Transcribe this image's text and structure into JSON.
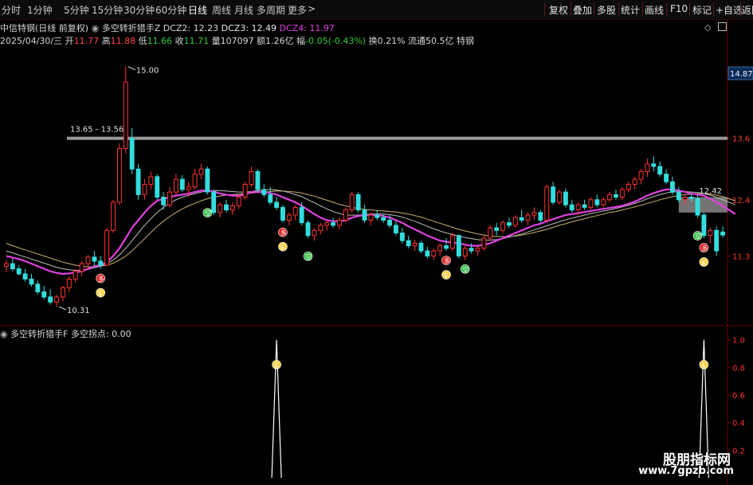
{
  "toolbar": {
    "periods": [
      "分时",
      "1分钟",
      "5分钟",
      "15分钟",
      "30分钟",
      "60分钟",
      "日线",
      "周线",
      "月线",
      "多周期",
      "更多"
    ],
    "active_period": "日线",
    "more_glyph": ">",
    "actions": [
      "复权",
      "叠加",
      "多股",
      "统计",
      "画线",
      "F10",
      "标记",
      "+自选",
      "返回"
    ]
  },
  "info": {
    "title": "中信特钢(日线 前复权)",
    "indicator_name": "多空转折猎手Z",
    "dcz2": "DCZ2: 12.23",
    "dcz3": "DCZ3: 12.49",
    "dcz4": "DCZ4: 11.97",
    "date": "2025/04/30/三",
    "open_label": "开",
    "open": "11.77",
    "high_label": "高",
    "high": "11.88",
    "low_label": "低",
    "low": "11.66",
    "close_label": "收",
    "close": "11.71",
    "vol_label": "量",
    "vol": "107097",
    "amt_label": "额",
    "amt": "1.26亿",
    "chg_label": "幅",
    "chg": "-0.05(-0.43%)",
    "turnover": "换0.21%",
    "float": "流通50.5亿",
    "sector": "特钢"
  },
  "chart_data": [
    {
      "type": "candlestick",
      "title": "中信特钢(日线 前复权)",
      "yaxis_ticks": [
        14.87,
        13.6,
        12.4,
        11.3
      ],
      "ylim": [
        10.0,
        15.4
      ],
      "annotations": {
        "max_label": "15.00",
        "min_label": "10.31",
        "range_label": "13.65 - 13.56",
        "last_label": "12.42",
        "price_tag": "14.87"
      },
      "ohlc": [
        [
          11.1,
          11.22,
          10.98,
          11.15
        ],
        [
          11.15,
          11.25,
          11.0,
          11.05
        ],
        [
          11.05,
          11.12,
          10.92,
          10.95
        ],
        [
          10.95,
          11.05,
          10.8,
          10.85
        ],
        [
          10.85,
          10.95,
          10.7,
          10.75
        ],
        [
          10.75,
          10.82,
          10.55,
          10.6
        ],
        [
          10.6,
          10.72,
          10.45,
          10.5
        ],
        [
          10.5,
          10.65,
          10.35,
          10.4
        ],
        [
          10.4,
          10.55,
          10.31,
          10.5
        ],
        [
          10.5,
          10.72,
          10.42,
          10.68
        ],
        [
          10.68,
          10.9,
          10.6,
          10.85
        ],
        [
          10.85,
          11.05,
          10.78,
          11.0
        ],
        [
          11.0,
          11.2,
          10.9,
          11.15
        ],
        [
          11.15,
          11.32,
          11.05,
          11.28
        ],
        [
          11.28,
          11.4,
          11.1,
          11.2
        ],
        [
          11.2,
          11.3,
          11.05,
          11.12
        ],
        [
          11.12,
          11.85,
          11.1,
          11.8
        ],
        [
          11.8,
          12.4,
          11.75,
          12.35
        ],
        [
          12.35,
          13.5,
          12.3,
          13.4
        ],
        [
          13.4,
          15.0,
          13.3,
          14.7
        ],
        [
          13.6,
          13.8,
          12.9,
          13.0
        ],
        [
          13.0,
          13.1,
          12.4,
          12.5
        ],
        [
          12.5,
          12.8,
          12.4,
          12.7
        ],
        [
          12.7,
          12.95,
          12.6,
          12.85
        ],
        [
          12.85,
          12.9,
          12.4,
          12.45
        ],
        [
          12.45,
          12.55,
          12.2,
          12.3
        ],
        [
          12.3,
          12.65,
          12.25,
          12.55
        ],
        [
          12.55,
          12.9,
          12.5,
          12.8
        ],
        [
          12.8,
          12.88,
          12.55,
          12.6
        ],
        [
          12.6,
          12.75,
          12.45,
          12.65
        ],
        [
          12.65,
          13.0,
          12.6,
          12.9
        ],
        [
          12.9,
          13.1,
          12.8,
          13.0
        ],
        [
          13.0,
          13.05,
          12.5,
          12.55
        ],
        [
          12.55,
          12.6,
          12.1,
          12.15
        ],
        [
          12.15,
          12.35,
          12.05,
          12.3
        ],
        [
          12.3,
          12.4,
          12.15,
          12.2
        ],
        [
          12.2,
          12.35,
          12.1,
          12.28
        ],
        [
          12.28,
          12.5,
          12.22,
          12.45
        ],
        [
          12.45,
          12.75,
          12.4,
          12.7
        ],
        [
          12.7,
          13.05,
          12.65,
          12.95
        ],
        [
          12.95,
          13.0,
          12.55,
          12.6
        ],
        [
          12.6,
          12.7,
          12.45,
          12.5
        ],
        [
          12.5,
          12.65,
          12.3,
          12.35
        ],
        [
          12.35,
          12.45,
          12.2,
          12.25
        ],
        [
          12.25,
          12.3,
          11.95,
          12.0
        ],
        [
          12.0,
          12.15,
          11.9,
          12.1
        ],
        [
          12.1,
          12.3,
          12.0,
          12.25
        ],
        [
          12.25,
          12.35,
          11.9,
          11.95
        ],
        [
          11.95,
          12.0,
          11.65,
          11.7
        ],
        [
          11.7,
          11.85,
          11.6,
          11.8
        ],
        [
          11.8,
          11.95,
          11.72,
          11.9
        ],
        [
          11.9,
          12.0,
          11.8,
          11.95
        ],
        [
          11.95,
          12.05,
          11.85,
          11.9
        ],
        [
          11.9,
          12.05,
          11.82,
          12.0
        ],
        [
          12.0,
          12.25,
          11.95,
          12.2
        ],
        [
          12.2,
          12.55,
          12.15,
          12.5
        ],
        [
          12.5,
          12.55,
          12.15,
          12.2
        ],
        [
          12.2,
          12.3,
          11.95,
          12.0
        ],
        [
          12.0,
          12.15,
          11.9,
          12.1
        ],
        [
          12.1,
          12.2,
          12.0,
          12.05
        ],
        [
          12.05,
          12.12,
          11.95,
          12.0
        ],
        [
          12.0,
          12.1,
          11.85,
          11.9
        ],
        [
          11.9,
          11.98,
          11.7,
          11.75
        ],
        [
          11.75,
          11.85,
          11.55,
          11.6
        ],
        [
          11.6,
          11.7,
          11.45,
          11.5
        ],
        [
          11.5,
          11.62,
          11.4,
          11.55
        ],
        [
          11.55,
          11.6,
          11.35,
          11.4
        ],
        [
          11.4,
          11.48,
          11.25,
          11.3
        ],
        [
          11.3,
          11.45,
          11.22,
          11.4
        ],
        [
          11.4,
          11.55,
          11.3,
          11.5
        ],
        [
          11.5,
          11.65,
          11.4,
          11.45
        ],
        [
          11.45,
          11.75,
          11.4,
          11.7
        ],
        [
          11.7,
          11.72,
          11.25,
          11.3
        ],
        [
          11.3,
          11.5,
          11.22,
          11.45
        ],
        [
          11.45,
          11.55,
          11.35,
          11.4
        ],
        [
          11.4,
          11.5,
          11.3,
          11.45
        ],
        [
          11.45,
          11.7,
          11.4,
          11.65
        ],
        [
          11.65,
          11.9,
          11.6,
          11.85
        ],
        [
          11.85,
          11.95,
          11.7,
          11.8
        ],
        [
          11.8,
          12.0,
          11.75,
          11.95
        ],
        [
          11.95,
          12.05,
          11.85,
          11.9
        ],
        [
          11.9,
          12.1,
          11.85,
          12.05
        ],
        [
          12.05,
          12.2,
          11.95,
          12.0
        ],
        [
          12.0,
          12.15,
          11.9,
          12.1
        ],
        [
          12.1,
          12.25,
          12.0,
          12.15
        ],
        [
          12.15,
          12.2,
          11.95,
          12.0
        ],
        [
          12.0,
          12.7,
          11.98,
          12.65
        ],
        [
          12.65,
          12.75,
          12.3,
          12.35
        ],
        [
          12.35,
          12.6,
          12.3,
          12.55
        ],
        [
          12.55,
          12.62,
          12.25,
          12.3
        ],
        [
          12.3,
          12.4,
          12.15,
          12.2
        ],
        [
          12.2,
          12.35,
          12.1,
          12.3
        ],
        [
          12.3,
          12.4,
          12.2,
          12.25
        ],
        [
          12.25,
          12.45,
          12.2,
          12.4
        ],
        [
          12.4,
          12.5,
          12.25,
          12.3
        ],
        [
          12.3,
          12.45,
          12.25,
          12.4
        ],
        [
          12.4,
          12.55,
          12.35,
          12.5
        ],
        [
          12.5,
          12.6,
          12.4,
          12.45
        ],
        [
          12.45,
          12.65,
          12.4,
          12.6
        ],
        [
          12.6,
          12.75,
          12.55,
          12.7
        ],
        [
          12.7,
          12.85,
          12.6,
          12.8
        ],
        [
          12.8,
          13.0,
          12.7,
          12.95
        ],
        [
          12.95,
          13.2,
          12.85,
          13.1
        ],
        [
          13.1,
          13.25,
          12.95,
          13.05
        ],
        [
          13.05,
          13.15,
          12.85,
          12.9
        ],
        [
          12.9,
          13.0,
          12.7,
          12.75
        ],
        [
          12.75,
          12.85,
          12.5,
          12.55
        ],
        [
          12.55,
          12.65,
          12.35,
          12.4
        ],
        [
          12.4,
          12.5,
          12.3,
          12.45
        ],
        [
          12.45,
          12.52,
          12.35,
          12.42
        ],
        [
          12.42,
          12.48,
          12.05,
          12.1
        ],
        [
          12.1,
          12.15,
          11.65,
          11.7
        ],
        [
          11.7,
          11.85,
          11.55,
          11.8
        ],
        [
          11.8,
          11.88,
          11.3,
          11.4
        ],
        [
          11.77,
          11.88,
          11.66,
          11.71
        ]
      ],
      "ma_purple": [
        11.3,
        11.27,
        11.24,
        11.2,
        11.15,
        11.1,
        11.05,
        11.0,
        10.97,
        10.95,
        10.96,
        10.98,
        11.0,
        11.05,
        11.1,
        11.12,
        11.18,
        11.3,
        11.45,
        11.65,
        11.85,
        12.0,
        12.15,
        12.28,
        12.38,
        12.42,
        12.45,
        12.48,
        12.5,
        12.52,
        12.55,
        12.58,
        12.58,
        12.56,
        12.52,
        12.5,
        12.48,
        12.48,
        12.5,
        12.55,
        12.55,
        12.55,
        12.53,
        12.5,
        12.45,
        12.4,
        12.35,
        12.28,
        12.2,
        12.12,
        12.05,
        12.0,
        11.98,
        11.98,
        12.0,
        12.05,
        12.08,
        12.1,
        12.1,
        12.1,
        12.08,
        12.05,
        12.0,
        11.95,
        11.88,
        11.82,
        11.76,
        11.7,
        11.65,
        11.6,
        11.58,
        11.56,
        11.55,
        11.52,
        11.5,
        11.5,
        11.52,
        11.55,
        11.6,
        11.65,
        11.7,
        11.75,
        11.8,
        11.85,
        11.9,
        11.93,
        11.98,
        12.02,
        12.06,
        12.1,
        12.12,
        12.14,
        12.16,
        12.18,
        12.2,
        12.22,
        12.24,
        12.26,
        12.28,
        12.32,
        12.36,
        12.42,
        12.48,
        12.53,
        12.57,
        12.6,
        12.6,
        12.58,
        12.55,
        12.52,
        12.5,
        12.48,
        12.42,
        12.35,
        12.28,
        12.2,
        12.12
      ],
      "ma_white": [
        11.4,
        11.36,
        11.32,
        11.28,
        11.24,
        11.2,
        11.16,
        11.12,
        11.08,
        11.05,
        11.03,
        11.02,
        11.02,
        11.04,
        11.07,
        11.1,
        11.15,
        11.22,
        11.32,
        11.45,
        11.6,
        11.75,
        11.9,
        12.03,
        12.15,
        12.25,
        12.33,
        12.4,
        12.45,
        12.49,
        12.52,
        12.55,
        12.57,
        12.58,
        12.58,
        12.57,
        12.56,
        12.55,
        12.55,
        12.56,
        12.58,
        12.59,
        12.6,
        12.59,
        12.57,
        12.54,
        12.5,
        12.46,
        12.4,
        12.34,
        12.28,
        12.22,
        12.17,
        12.13,
        12.1,
        12.1,
        12.1,
        12.11,
        12.12,
        12.12,
        12.12,
        12.11,
        12.09,
        12.06,
        12.02,
        11.98,
        11.93,
        11.88,
        11.83,
        11.79,
        11.75,
        11.72,
        11.69,
        11.66,
        11.64,
        11.62,
        11.61,
        11.61,
        11.62,
        11.64,
        11.67,
        11.7,
        11.73,
        11.77,
        11.81,
        11.85,
        11.89,
        11.93,
        11.97,
        12.01,
        12.04,
        12.07,
        12.1,
        12.13,
        12.15,
        12.18,
        12.2,
        12.23,
        12.26,
        12.29,
        12.33,
        12.37,
        12.42,
        12.46,
        12.5,
        12.53,
        12.55,
        12.56,
        12.56,
        12.55,
        12.54,
        12.52,
        12.49,
        12.45,
        12.4,
        12.35,
        12.3
      ],
      "ma_yellow": [
        11.55,
        11.5,
        11.46,
        11.42,
        11.38,
        11.34,
        11.3,
        11.26,
        11.22,
        11.18,
        11.15,
        11.12,
        11.1,
        11.09,
        11.09,
        11.1,
        11.12,
        11.16,
        11.22,
        11.3,
        11.4,
        11.52,
        11.64,
        11.76,
        11.88,
        11.98,
        12.07,
        12.15,
        12.22,
        12.28,
        12.33,
        12.38,
        12.42,
        12.45,
        12.47,
        12.49,
        12.5,
        12.51,
        12.52,
        12.53,
        12.54,
        12.55,
        12.56,
        12.57,
        12.57,
        12.56,
        12.55,
        12.53,
        12.5,
        12.47,
        12.43,
        12.39,
        12.35,
        12.31,
        12.28,
        12.25,
        12.23,
        12.21,
        12.2,
        12.19,
        12.18,
        12.17,
        12.16,
        12.14,
        12.12,
        12.09,
        12.06,
        12.02,
        11.98,
        11.94,
        11.9,
        11.86,
        11.82,
        11.79,
        11.76,
        11.73,
        11.71,
        11.69,
        11.68,
        11.68,
        11.68,
        11.69,
        11.71,
        11.73,
        11.76,
        11.79,
        11.82,
        11.86,
        11.9,
        11.93,
        11.97,
        12.0,
        12.03,
        12.06,
        12.09,
        12.12,
        12.15,
        12.17,
        12.2,
        12.23,
        12.26,
        12.29,
        12.33,
        12.36,
        12.4,
        12.43,
        12.46,
        12.48,
        12.5,
        12.51,
        12.52,
        12.52,
        12.51,
        12.49,
        12.46,
        12.42,
        12.38
      ],
      "signals_buy_red": [
        15,
        44,
        70,
        111
      ],
      "signals_buy_gold": [
        15,
        44,
        70,
        111
      ],
      "signals_sell_green": [
        32,
        48,
        73,
        110
      ]
    },
    {
      "type": "line",
      "title": "多空转折猎手F",
      "series": [
        {
          "name": "多空拐点",
          "spike_indices": [
            43,
            111
          ],
          "spike_value": 1.0
        }
      ],
      "yaxis_ticks": [
        1.0,
        0.8,
        0.6,
        0.4,
        0.2
      ],
      "ylim": [
        0.0,
        1.05
      ]
    }
  ],
  "lower_panel": {
    "title": "多空转折猎手F",
    "value_label": "多空拐点: 0.00"
  },
  "watermark": {
    "line1": "股朋指标网",
    "line2": "www.7gpzb.com"
  },
  "colors": {
    "up": "#ff3333",
    "down": "#33dddd",
    "ma_purple": "#e040e0",
    "grid": "#6a0000",
    "ref_line": "#999999",
    "signal_green": "#33bb44",
    "signal_red": "#dd2222",
    "signal_gold": "#ffd24a"
  },
  "icons": {
    "panel": "gear-icon",
    "diamond": "diamond-icon",
    "window": "window-icon"
  }
}
